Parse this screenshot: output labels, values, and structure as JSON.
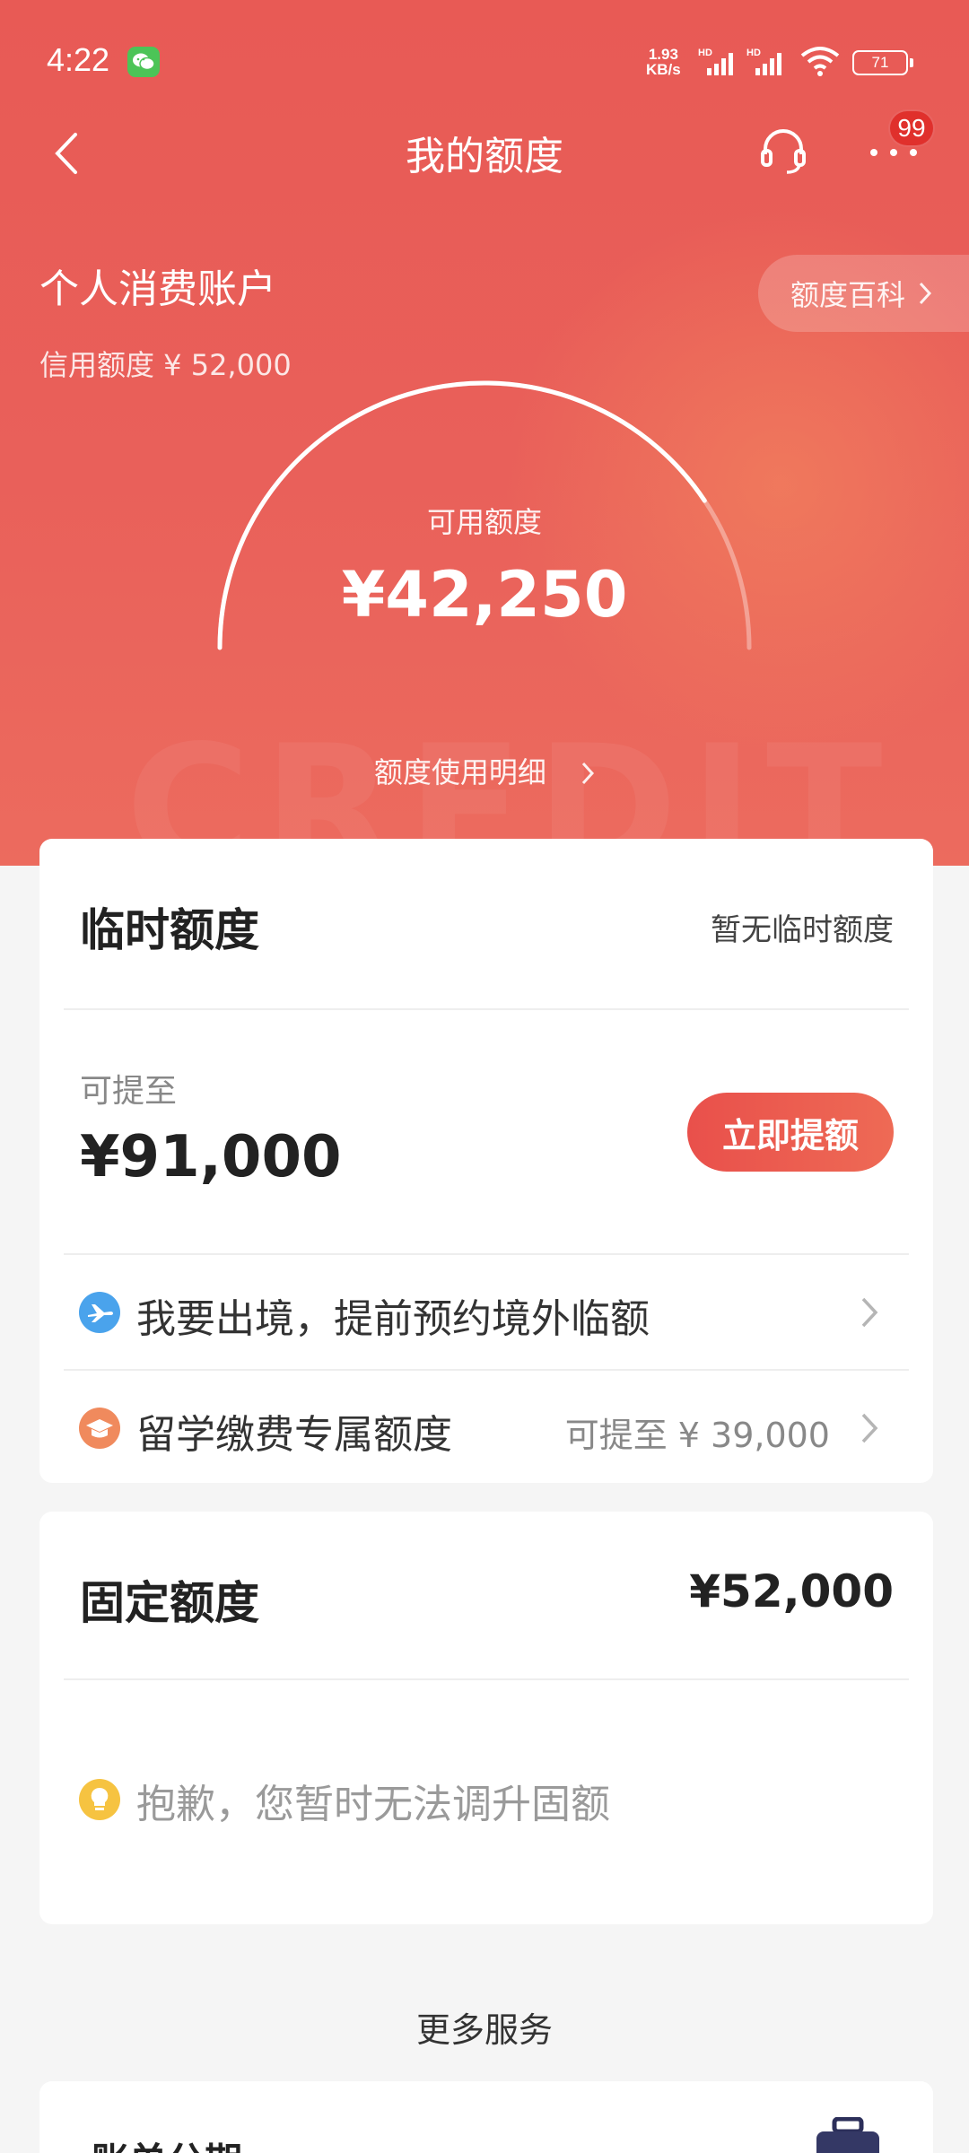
{
  "status_bar": {
    "time": "4:22",
    "speed_top": "1.93",
    "speed_bottom": "KB/s",
    "battery": "71"
  },
  "nav": {
    "title": "我的额度",
    "badge": "99"
  },
  "account": {
    "title": "个人消费账户",
    "credit_limit": "信用额度 ¥ 52,000",
    "wiki_link": "额度百科"
  },
  "gauge": {
    "label": "可用额度",
    "value": "¥42,250",
    "available_fraction": 0.8125,
    "usage_link": "额度使用明细"
  },
  "temporary": {
    "title": "临时额度",
    "status": "暂无临时额度",
    "raise_label": "可提至",
    "raise_amount": "¥91,000",
    "raise_button": "立即提额",
    "rows": [
      {
        "text": "我要出境，提前预约境外临额",
        "value": "",
        "icon": "plane-icon"
      },
      {
        "text": "留学缴费专属额度",
        "value": "可提至 ¥ 39,000",
        "icon": "graduation-cap-icon"
      }
    ]
  },
  "fixed": {
    "title": "固定额度",
    "amount": "¥52,000",
    "tip": "抱歉，您暂时无法调升固额"
  },
  "more": {
    "title": "更多服务",
    "first_item": "账单分期"
  },
  "colors": {
    "brand_red": "#e85a55",
    "button_red": "#e9504b",
    "tip_yellow": "#f6c341",
    "plane_blue": "#4aa3ec",
    "cap_orange": "#f08a5d"
  }
}
